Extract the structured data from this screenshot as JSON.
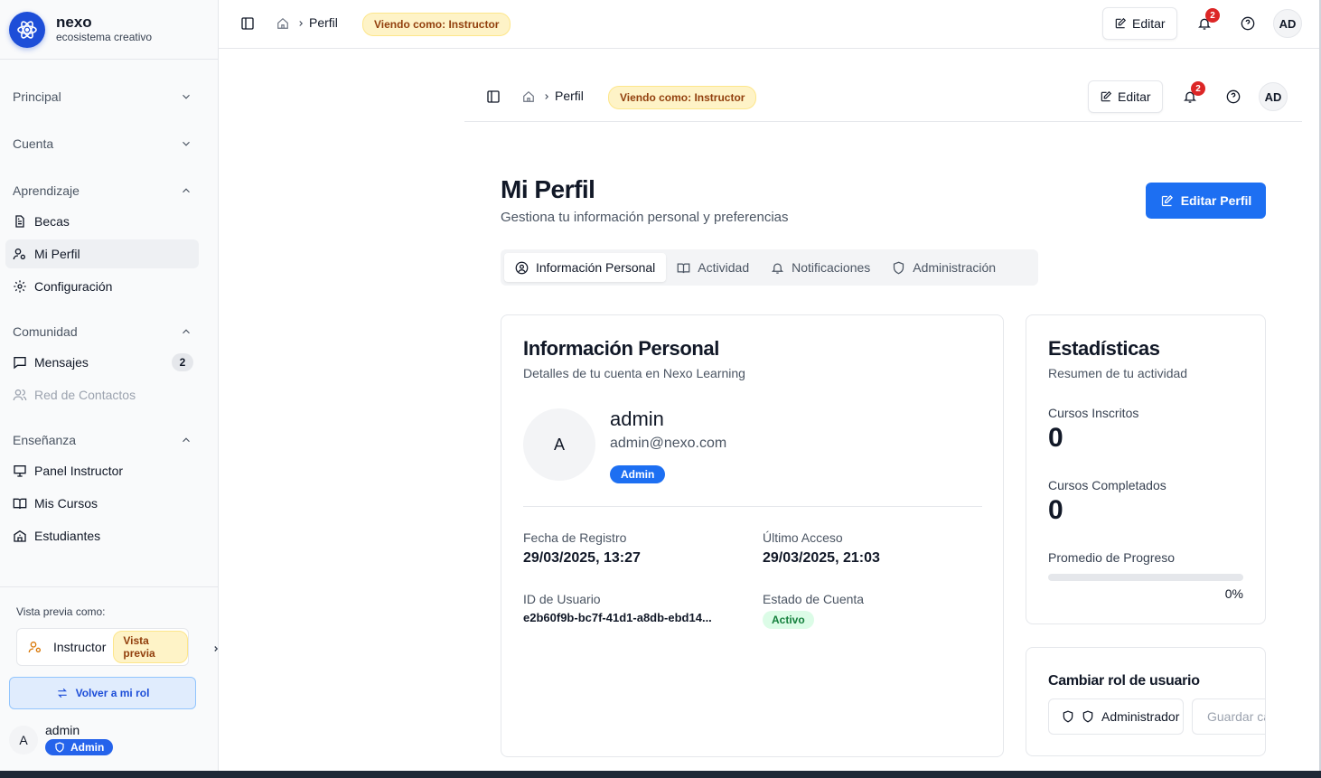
{
  "brand": {
    "name": "nexo",
    "subtitle": "ecosistema creativo"
  },
  "sidebar": {
    "sections": [
      {
        "label": "Principal"
      },
      {
        "label": "Cuenta"
      },
      {
        "label": "Aprendizaje",
        "items": [
          {
            "label": "Becas",
            "icon": "document-icon"
          },
          {
            "label": "Mi Perfil",
            "icon": "user-cog-icon",
            "active": true
          },
          {
            "label": "Configuración",
            "icon": "gear-icon"
          }
        ]
      },
      {
        "label": "Comunidad",
        "items": [
          {
            "label": "Mensajes",
            "icon": "message-icon",
            "badge": "2"
          },
          {
            "label": "Red de Contactos",
            "icon": "users-icon",
            "disabled": true
          }
        ]
      },
      {
        "label": "Enseñanza",
        "items": [
          {
            "label": "Panel Instructor",
            "icon": "presentation-icon"
          },
          {
            "label": "Mis Cursos",
            "icon": "book-icon"
          },
          {
            "label": "Estudiantes",
            "icon": "school-icon"
          }
        ]
      }
    ],
    "preview": {
      "label": "Vista previa como:",
      "role": "Instructor",
      "chip": "Vista previa",
      "back_button": "Volver a mi rol"
    },
    "user": {
      "initial": "A",
      "name": "admin",
      "badge": "Admin"
    }
  },
  "topbar": {
    "crumb": "Perfil",
    "view_chip": "Viendo como: Instructor",
    "edit_label": "Editar",
    "notif_count": "2",
    "avatar": "AD"
  },
  "page": {
    "title": "Mi Perfil",
    "subtitle": "Gestiona tu información personal y preferencias",
    "edit_profile": "Editar Perfil"
  },
  "tabs": [
    {
      "label": "Información Personal",
      "icon": "user-circle-icon"
    },
    {
      "label": "Actividad",
      "icon": "book-open-icon"
    },
    {
      "label": "Notificaciones",
      "icon": "bell-icon"
    },
    {
      "label": "Administración",
      "icon": "shield-icon"
    }
  ],
  "personal": {
    "title": "Información Personal",
    "subtitle": "Detalles de tu cuenta en Nexo Learning",
    "avatar": "A",
    "name": "admin",
    "email": "admin@nexo.com",
    "role": "Admin",
    "registro_label": "Fecha de Registro",
    "registro_value": "29/03/2025, 13:27",
    "acceso_label": "Último Acceso",
    "acceso_value": "29/03/2025, 21:03",
    "id_label": "ID de Usuario",
    "id_value": "e2b60f9b-bc7f-41d1-a8db-ebd14...",
    "estado_label": "Estado de Cuenta",
    "estado_value": "Activo"
  },
  "stats": {
    "title": "Estadísticas",
    "subtitle": "Resumen de tu actividad",
    "inscritos_label": "Cursos Inscritos",
    "inscritos_value": "0",
    "completados_label": "Cursos Completados",
    "completados_value": "0",
    "progreso_label": "Promedio de Progreso",
    "progreso_value": "0%",
    "progreso_fraction": 0
  },
  "role_card": {
    "title": "Cambiar rol de usuario",
    "selected": "Administrador",
    "save": "Guardar cambio"
  },
  "colors": {
    "primary": "#1d6ff2",
    "notif": "#dc2626",
    "chip_bg": "#fef3c7",
    "chip_text": "#92400e",
    "active_green": "#15803d"
  }
}
